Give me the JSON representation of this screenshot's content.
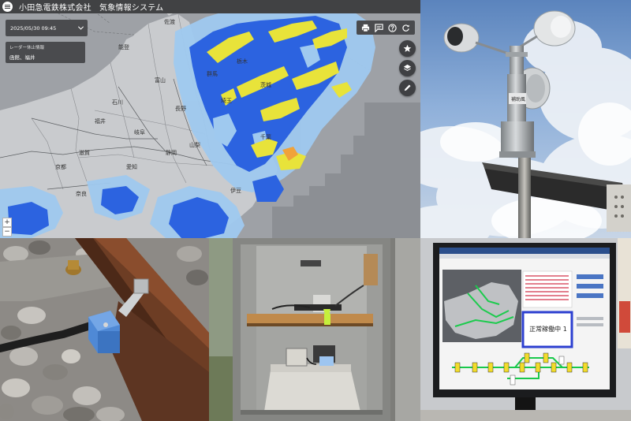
{
  "app": {
    "title": "小田急電鉄株式会社　気象情報システム"
  },
  "date_selector": {
    "value": "2025/05/30 09:45"
  },
  "radar_alert": {
    "title": "レーダー休止情報",
    "body": "函館、福井"
  },
  "toolbar": {
    "icons": [
      "print-icon",
      "comment-icon",
      "help-icon",
      "refresh-icon"
    ]
  },
  "fabs": [
    "star-icon",
    "layers-icon",
    "pencil-icon"
  ],
  "zoom": {
    "in_label": "+",
    "out_label": "−"
  },
  "map_labels": {
    "cities": [
      "石川",
      "富山",
      "福井",
      "岐阜",
      "長野",
      "山梨",
      "静岡",
      "愛知",
      "滋賀",
      "京都",
      "奈良",
      "群馬",
      "栃木",
      "茨城",
      "埼玉",
      "千葉",
      "伊豆",
      "能登",
      "佐渡"
    ]
  },
  "monitor_screen": {
    "status_text": "正常稼働中 1"
  },
  "colors": {
    "app_bar": "#414244",
    "panel_bg": "#4a4b4e",
    "radar_light": "#9fc9ef",
    "radar_blue": "#2c63e0",
    "radar_yellow": "#e8e33a",
    "radar_orange": "#f0a23a",
    "map_land": "#c9cbce",
    "map_sea": "#9ea1a6"
  }
}
